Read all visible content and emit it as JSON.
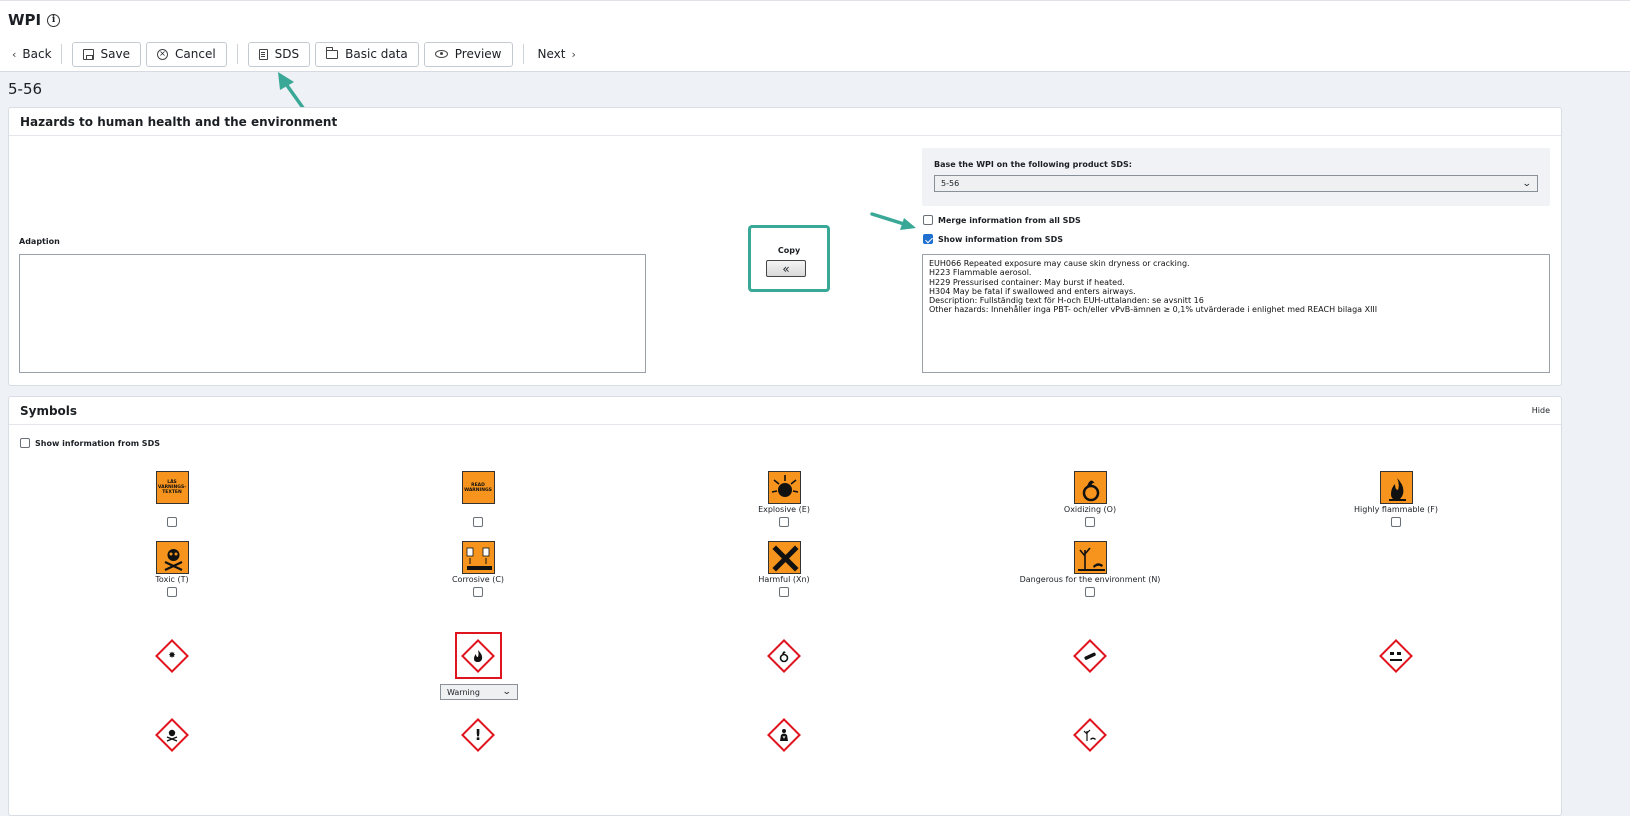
{
  "app": {
    "title": "WPI",
    "info_icon": "info-icon"
  },
  "toolbar": {
    "back": "Back",
    "save": "Save",
    "cancel": "Cancel",
    "sds": "SDS",
    "basic_data": "Basic data",
    "preview": "Preview",
    "next": "Next"
  },
  "page": {
    "title": "5-56"
  },
  "hazards": {
    "heading": "Hazards to human health and the environment",
    "adaption_label": "Adaption",
    "adaption_value": "",
    "copy_label": "Copy",
    "copy_button": "«",
    "base_label": "Base the WPI on the following product SDS:",
    "base_selected": "5-56",
    "merge_label": "Merge information from all SDS",
    "merge_checked": false,
    "show_label": "Show information from SDS",
    "show_checked": true,
    "sds_text": "EUH066 Repeated exposure may cause skin dryness or cracking.\nH223 Flammable aerosol.\nH229 Pressurised container: May burst if heated.\nH304 May be fatal if swallowed and enters airways.\nDescription: Fullständig text för H-och EUH-uttalanden: se avsnitt 16\nOther hazards: Innehåller inga PBT- och/eller vPvB-ämnen ≥ 0,1% utvärderade i enlighet med REACH bilaga XIII"
  },
  "symbols": {
    "heading": "Symbols",
    "hide": "Hide",
    "show_label": "Show information from SDS",
    "orange": [
      {
        "label": "",
        "img_text": "LÄS VARNINGS-TEXTEN",
        "icon": "read-warnings-sv-icon"
      },
      {
        "label": "",
        "img_text": "READ WARNINGS",
        "icon": "read-warnings-icon"
      },
      {
        "label": "Explosive (E)",
        "img_text": "",
        "icon": "explosive-icon"
      },
      {
        "label": "Oxidizing (O)",
        "img_text": "",
        "icon": "oxidizing-icon"
      },
      {
        "label": "Highly flammable (F)",
        "img_text": "",
        "icon": "flame-icon"
      },
      {
        "label": "Toxic (T)",
        "img_text": "",
        "icon": "skull-icon"
      },
      {
        "label": "Corrosive (C)",
        "img_text": "",
        "icon": "corrosive-icon"
      },
      {
        "label": "Harmful (Xn)",
        "img_text": "",
        "icon": "harmful-cross-icon"
      },
      {
        "label": "Dangerous for the environment (N)",
        "img_text": "",
        "icon": "environment-icon"
      }
    ],
    "ghs": [
      {
        "icon": "ghs-explosive-icon"
      },
      {
        "icon": "ghs-flame-icon",
        "selected": true,
        "signal": "Warning"
      },
      {
        "icon": "ghs-oxidizing-icon"
      },
      {
        "icon": "ghs-gas-cylinder-icon"
      },
      {
        "icon": "ghs-corrosive-icon"
      },
      {
        "icon": "ghs-skull-icon"
      },
      {
        "icon": "ghs-exclamation-icon"
      },
      {
        "icon": "ghs-health-hazard-icon"
      },
      {
        "icon": "ghs-environment-icon"
      }
    ]
  },
  "colors": {
    "accent_teal": "#3aa896",
    "ghs_red": "#e0141e",
    "orange": "#f7941d",
    "checkbox_blue": "#1f6fd1"
  }
}
